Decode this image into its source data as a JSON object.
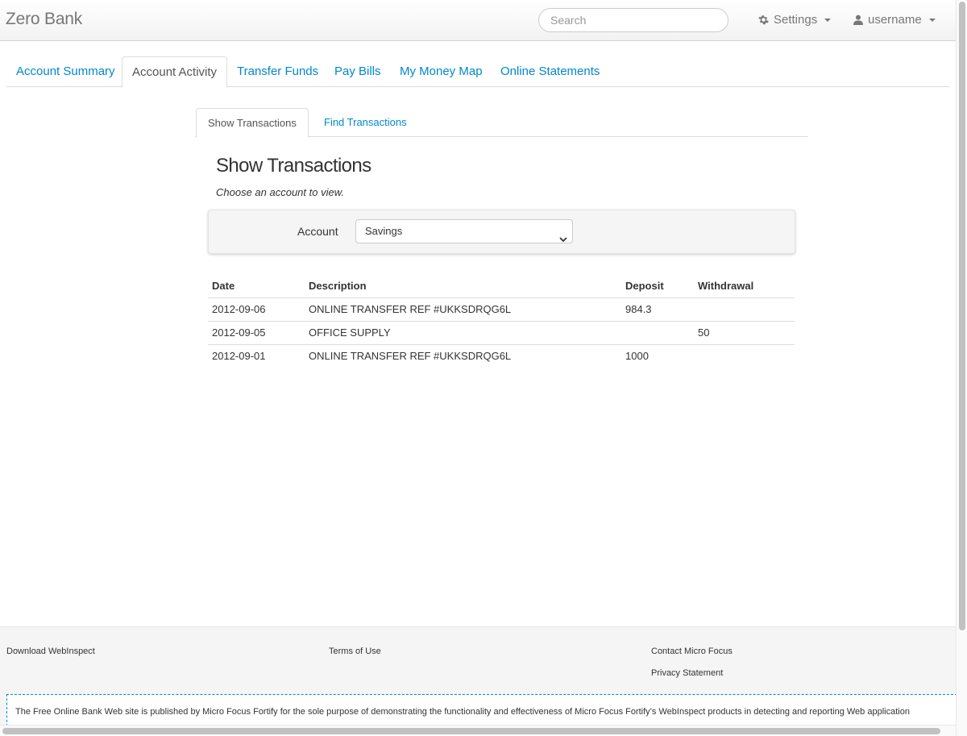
{
  "navbar": {
    "brand": "Zero Bank",
    "search_placeholder": "Search",
    "settings_label": "Settings",
    "user_label": "username"
  },
  "main_tabs": [
    {
      "label": "Account Summary"
    },
    {
      "label": "Account Activity",
      "active": true
    },
    {
      "label": "Transfer Funds"
    },
    {
      "label": "Pay Bills"
    },
    {
      "label": "My Money Map"
    },
    {
      "label": "Online Statements"
    }
  ],
  "sub_tabs": [
    {
      "label": "Show Transactions",
      "active": true
    },
    {
      "label": "Find Transactions"
    }
  ],
  "content": {
    "title": "Show Transactions",
    "hint": "Choose an account to view.",
    "account_label": "Account",
    "account_selected": "Savings"
  },
  "table": {
    "headers": [
      "Date",
      "Description",
      "Deposit",
      "Withdrawal"
    ],
    "rows": [
      {
        "date": "2012-09-06",
        "description": "ONLINE TRANSFER REF #UKKSDRQG6L",
        "deposit": "984.3",
        "withdrawal": ""
      },
      {
        "date": "2012-09-05",
        "description": "OFFICE SUPPLY",
        "deposit": "",
        "withdrawal": "50"
      },
      {
        "date": "2012-09-01",
        "description": "ONLINE TRANSFER REF #UKKSDRQG6L",
        "deposit": "1000",
        "withdrawal": ""
      }
    ]
  },
  "footer": {
    "download": "Download WebInspect",
    "terms": "Terms of Use",
    "contact": "Contact Micro Focus",
    "privacy": "Privacy Statement",
    "disclaimer": "The Free Online Bank Web site is published by Micro Focus Fortify for the sole purpose of demonstrating the functionality and effectiveness of Micro Focus Fortify’s WebInspect products in detecting and reporting Web application"
  },
  "colors": {
    "link": "#0088cc",
    "text": "#333333",
    "muted": "#777777"
  },
  "icons": {
    "settings": "gear-icon",
    "user": "user-icon",
    "select": "chevron-down-icon"
  }
}
